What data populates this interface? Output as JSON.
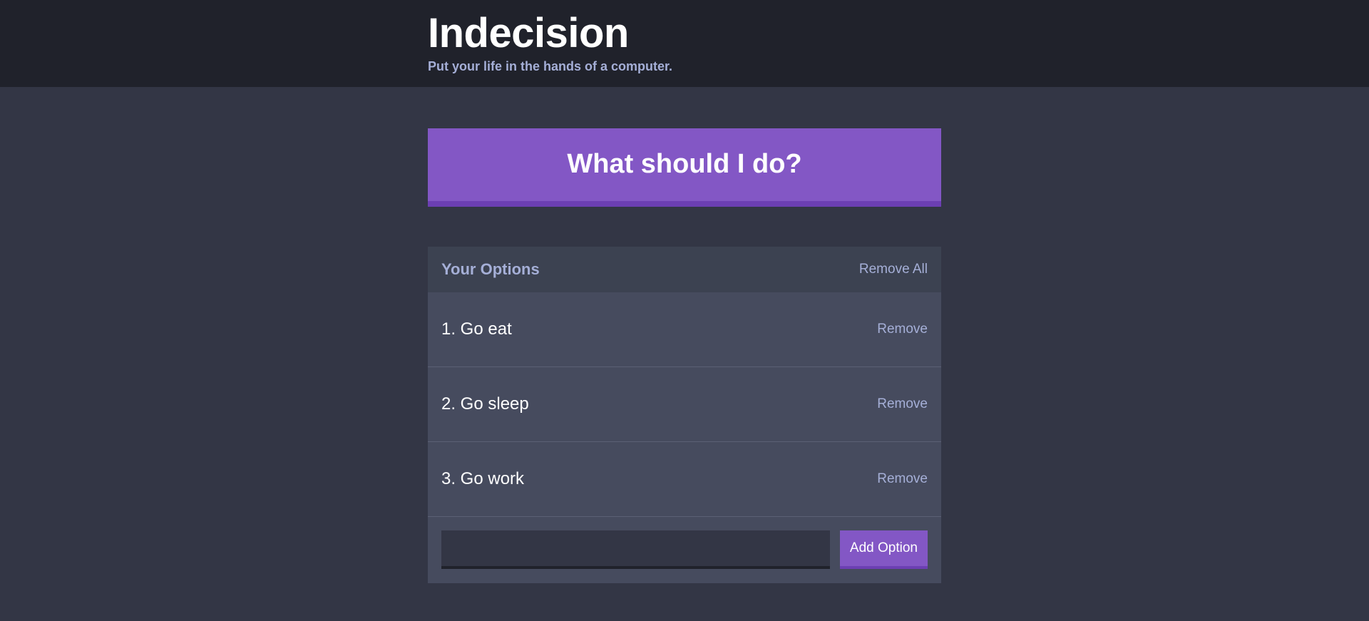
{
  "header": {
    "title": "Indecision",
    "subtitle": "Put your life in the hands of a computer."
  },
  "action": {
    "label": "What should I do?"
  },
  "options_widget": {
    "title": "Your Options",
    "remove_all_label": "Remove All",
    "items": [
      {
        "text": "1. Go eat",
        "remove_label": "Remove"
      },
      {
        "text": "2. Go sleep",
        "remove_label": "Remove"
      },
      {
        "text": "3. Go work",
        "remove_label": "Remove"
      }
    ],
    "add_form": {
      "input_value": "",
      "button_label": "Add Option"
    }
  },
  "colors": {
    "header_bg": "#20222b",
    "page_bg": "#333645",
    "accent": "#8357c5",
    "accent_dark": "#6c3fb3",
    "widget_header_bg": "#3c4251",
    "widget_bg": "#464b5e",
    "muted_text": "#a5afd7"
  }
}
